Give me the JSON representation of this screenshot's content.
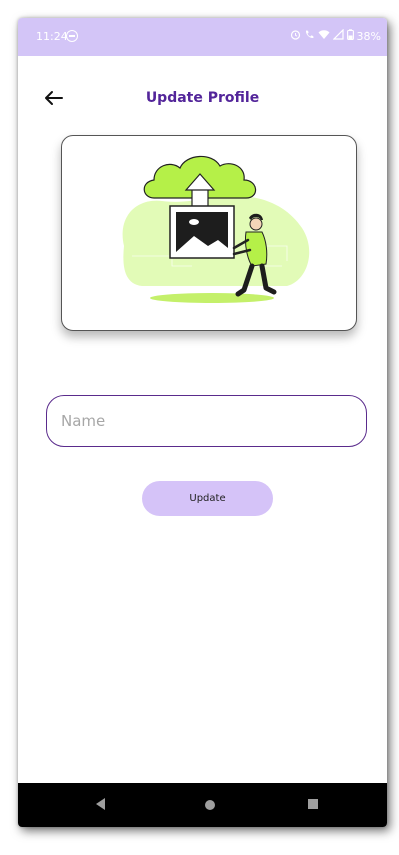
{
  "status_bar": {
    "time": "11:24",
    "battery": "38%",
    "background": "#d3c5f7"
  },
  "header": {
    "title": "Update Profile",
    "back_icon": "arrow-left-icon",
    "title_color": "#53259a"
  },
  "profile_image": {
    "illustration": "upload-image-illustration"
  },
  "form": {
    "name_placeholder": "Name",
    "name_value": "",
    "submit_label": "Update",
    "accent": "#d5c3f8",
    "border_color": "#5a2b8c"
  },
  "nav_bar": {
    "icons": [
      "nav-back-icon",
      "nav-home-icon",
      "nav-recents-icon"
    ]
  }
}
